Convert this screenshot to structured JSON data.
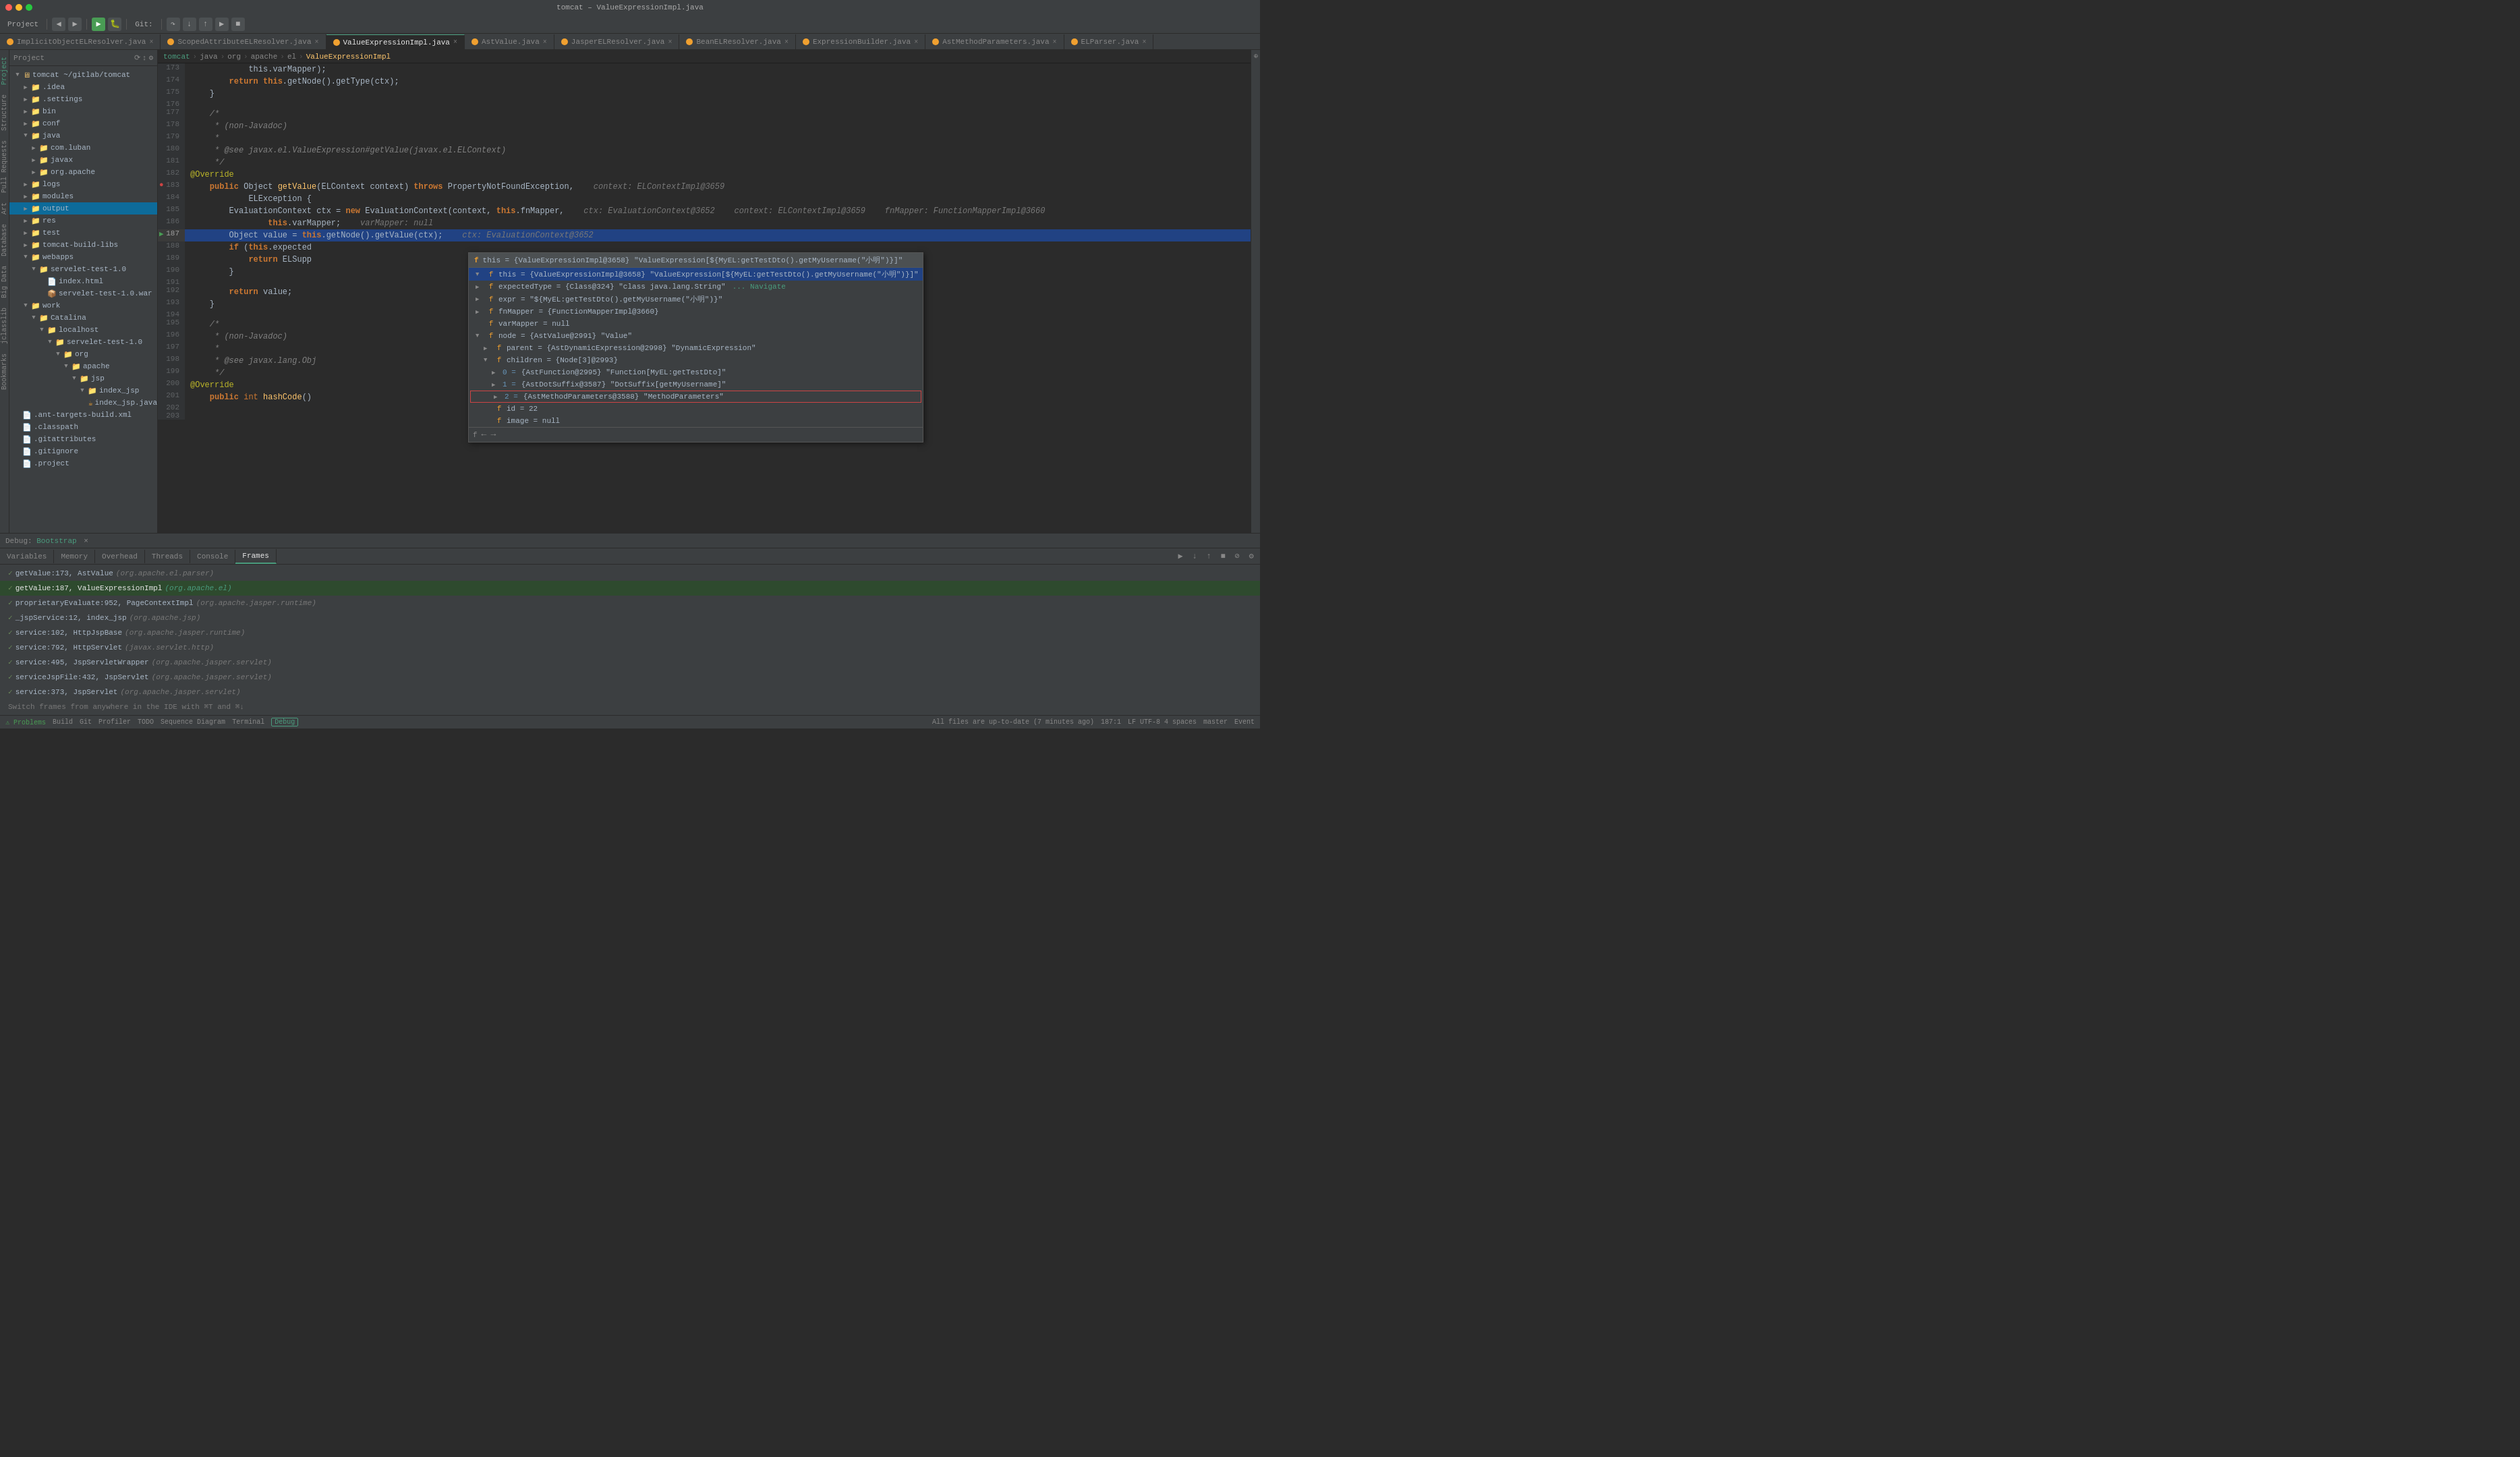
{
  "window": {
    "title": "tomcat – ValueExpressionImpl.java"
  },
  "toolbar": {
    "project_label": "Project",
    "git_label": "Git:",
    "bootstrap_label": "Bootstrap"
  },
  "tabs": [
    {
      "label": "ImplicitObjectELResolver.java",
      "active": false,
      "type": "java"
    },
    {
      "label": "ScopedAttributeELResolver.java",
      "active": false,
      "type": "java"
    },
    {
      "label": "ValueExpressionImpl.java",
      "active": true,
      "type": "java"
    },
    {
      "label": "AstValue.java",
      "active": false,
      "type": "java"
    },
    {
      "label": "JasperELResolver.java",
      "active": false,
      "type": "java"
    },
    {
      "label": "BeanELResolver.java",
      "active": false,
      "type": "java"
    },
    {
      "label": "ExpressionBuilder.java",
      "active": false,
      "type": "java"
    },
    {
      "label": "AstMethodParameters.java",
      "active": false,
      "type": "java"
    },
    {
      "label": "ELParser.java",
      "active": false,
      "type": "java"
    }
  ],
  "breadcrumb": {
    "items": [
      "tomcat",
      "java",
      "org",
      "apache",
      "el",
      "ValueExpressionImpl"
    ]
  },
  "sidebar": {
    "header": "Project",
    "items": [
      {
        "level": 0,
        "label": "tomcat ~/gitlab/tomcat",
        "expanded": true,
        "type": "root"
      },
      {
        "level": 1,
        "label": ".idea",
        "expanded": false,
        "type": "folder"
      },
      {
        "level": 1,
        "label": ".settings",
        "expanded": false,
        "type": "folder"
      },
      {
        "level": 1,
        "label": "bin",
        "expanded": false,
        "type": "folder"
      },
      {
        "level": 1,
        "label": "conf",
        "expanded": false,
        "type": "folder"
      },
      {
        "level": 1,
        "label": "java",
        "expanded": true,
        "type": "folder"
      },
      {
        "level": 2,
        "label": "com.luban",
        "expanded": false,
        "type": "folder"
      },
      {
        "level": 2,
        "label": "javax",
        "expanded": false,
        "type": "folder"
      },
      {
        "level": 2,
        "label": "org.apache",
        "expanded": false,
        "type": "folder"
      },
      {
        "level": 1,
        "label": "logs",
        "expanded": false,
        "type": "folder"
      },
      {
        "level": 1,
        "label": "modules",
        "expanded": false,
        "type": "folder"
      },
      {
        "level": 1,
        "label": "output",
        "expanded": false,
        "type": "folder",
        "selected": true
      },
      {
        "level": 1,
        "label": "res",
        "expanded": false,
        "type": "folder"
      },
      {
        "level": 1,
        "label": "test",
        "expanded": false,
        "type": "folder"
      },
      {
        "level": 1,
        "label": "tomcat-build-libs",
        "expanded": false,
        "type": "folder"
      },
      {
        "level": 1,
        "label": "webapps",
        "expanded": true,
        "type": "folder"
      },
      {
        "level": 2,
        "label": "servelet-test-1.0",
        "expanded": true,
        "type": "folder"
      },
      {
        "level": 3,
        "label": "index.html",
        "expanded": false,
        "type": "file"
      },
      {
        "level": 3,
        "label": "servelet-test-1.0.war",
        "expanded": false,
        "type": "file"
      },
      {
        "level": 1,
        "label": "work",
        "expanded": true,
        "type": "folder"
      },
      {
        "level": 2,
        "label": "Catalina",
        "expanded": true,
        "type": "folder"
      },
      {
        "level": 3,
        "label": "localhost",
        "expanded": true,
        "type": "folder"
      },
      {
        "level": 4,
        "label": "servelet-test-1.0",
        "expanded": true,
        "type": "folder"
      },
      {
        "level": 5,
        "label": "org",
        "expanded": true,
        "type": "folder"
      },
      {
        "level": 6,
        "label": "apache",
        "expanded": true,
        "type": "folder"
      },
      {
        "level": 7,
        "label": "jsp",
        "expanded": true,
        "type": "folder"
      },
      {
        "level": 8,
        "label": "index_jsp",
        "expanded": true,
        "type": "folder"
      },
      {
        "level": 9,
        "label": "index_jsp.java",
        "expanded": false,
        "type": "java"
      },
      {
        "level": 9,
        "label": "index_jsp.java",
        "expanded": false,
        "type": "java"
      },
      {
        "level": 1,
        "label": ".ant-targets-build.xml",
        "expanded": false,
        "type": "file"
      },
      {
        "level": 1,
        "label": ".classpath",
        "expanded": false,
        "type": "file"
      },
      {
        "level": 1,
        "label": ".gitattributes",
        "expanded": false,
        "type": "file"
      },
      {
        "level": 1,
        "label": ".gitignore",
        "expanded": false,
        "type": "file"
      },
      {
        "level": 1,
        "label": ".project",
        "expanded": false,
        "type": "file"
      }
    ]
  },
  "code": {
    "lines": [
      {
        "num": 173,
        "content": "            this.varMapper);"
      },
      {
        "num": 174,
        "content": "        return this.getNode().getType(ctx);"
      },
      {
        "num": 175,
        "content": "    }"
      },
      {
        "num": 176,
        "content": ""
      },
      {
        "num": 177,
        "content": "    /*"
      },
      {
        "num": 178,
        "content": "     * (non-Javadoc)"
      },
      {
        "num": 179,
        "content": "     *"
      },
      {
        "num": 180,
        "content": "     * @see javax.el.ValueExpression#getValue(javax.el.ELContext)"
      },
      {
        "num": 181,
        "content": "     */"
      },
      {
        "num": 182,
        "content": "@Override"
      },
      {
        "num": 183,
        "content": "    public Object getValue(ELContext context) throws PropertyNotFoundException,    context: ELContextImpl@3659"
      },
      {
        "num": 184,
        "content": "            ELException {"
      },
      {
        "num": 185,
        "content": "        EvaluationContext ctx = new EvaluationContext(context, this.fnMapper,    ctx: EvaluationContext@3652    context: ELContextImpl@3659    fnMapper: FunctionMapperImpl@3660"
      },
      {
        "num": 186,
        "content": "                this.varMapper;    varMapper: null"
      },
      {
        "num": 187,
        "content": "        Object value = this.getNode().getValue(ctx);    ctx: EvaluationContext@3652",
        "active": true
      },
      {
        "num": 188,
        "content": "        if (this.expected"
      },
      {
        "num": 189,
        "content": "            return ELSupp"
      },
      {
        "num": 190,
        "content": "        }"
      },
      {
        "num": 191,
        "content": ""
      },
      {
        "num": 192,
        "content": "        return value;"
      },
      {
        "num": 193,
        "content": "    }"
      },
      {
        "num": 194,
        "content": ""
      },
      {
        "num": 195,
        "content": "    /*"
      },
      {
        "num": 196,
        "content": "     * (non-Javadoc)"
      },
      {
        "num": 197,
        "content": "     *"
      },
      {
        "num": 198,
        "content": "     * @see javax.lang.Obj"
      },
      {
        "num": 199,
        "content": "     */"
      },
      {
        "num": 200,
        "content": "@Override"
      },
      {
        "num": 201,
        "content": "    public int hashCode()"
      },
      {
        "num": 202,
        "content": ""
      },
      {
        "num": 203,
        "content": ""
      }
    ]
  },
  "debug_popup": {
    "header": {
      "icon": "f",
      "text": "this = {ValueExpressionImpl@3658} \"ValueExpression[${MyEL:getTestDto().getMyUsername(\"小明\")}]\""
    },
    "items": [
      {
        "level": 1,
        "expanded": false,
        "field": "expectedType",
        "value": "{Class@324} \"class java.lang.String\"",
        "suffix": "... Navigate"
      },
      {
        "level": 1,
        "expanded": false,
        "field": "expr",
        "value": "\"${MyEL:getTestDto().getMyUsername(\\\"小明\\\")}\""
      },
      {
        "level": 1,
        "expanded": false,
        "field": "fnMapper",
        "value": "{FunctionMapperImpl@3660}"
      },
      {
        "level": 1,
        "expanded": false,
        "field": "varMapper",
        "value": "null"
      },
      {
        "level": 1,
        "expanded": true,
        "field": "node",
        "value": "{AstValue@2991} \"Value\""
      },
      {
        "level": 2,
        "expanded": false,
        "field": "parent",
        "value": "{AstDynamicExpression@2998} \"DynamicExpression\""
      },
      {
        "level": 2,
        "expanded": true,
        "field": "children",
        "value": "{Node[3]@2993}"
      },
      {
        "level": 3,
        "expanded": false,
        "field": "0",
        "value": "{AstFunction@2995} \"Function[MyEL:getTestDto]\""
      },
      {
        "level": 3,
        "expanded": false,
        "field": "1",
        "value": "{AstDotSuffix@3587} \"DotSuffix[getMyUsername]\""
      },
      {
        "level": 3,
        "expanded": false,
        "field": "2",
        "value": "{AstMethodParameters@3588} \"MethodParameters\"",
        "highlighted": true
      },
      {
        "level": 2,
        "expanded": false,
        "field": "id",
        "value": "= 22"
      },
      {
        "level": 2,
        "expanded": false,
        "field": "image",
        "value": "= null"
      }
    ]
  },
  "bottom_panel": {
    "debug_label": "Debug:",
    "bootstrap_label": "Bootstrap",
    "tabs": [
      {
        "label": "Variables",
        "active": false
      },
      {
        "label": "Memory",
        "active": false
      },
      {
        "label": "Overhead",
        "active": false
      },
      {
        "label": "Threads",
        "active": false
      },
      {
        "label": "Console",
        "active": false
      },
      {
        "label": "Frames",
        "active": true
      }
    ],
    "frames": [
      {
        "method": "getValue:173, AstValue",
        "pkg": "(org.apache.el.parser)",
        "active": false
      },
      {
        "method": "getValue:187, ValueExpressionImpl",
        "pkg": "(org.apache.el)",
        "active": true,
        "highlighted": true
      },
      {
        "method": "proprietaryEvaluate:952, PageContextImpl",
        "pkg": "(org.apache.jasper.runtime)",
        "active": false
      },
      {
        "method": "_jspService:12, index_jsp",
        "pkg": "(org.apache.jsp)",
        "active": false
      },
      {
        "method": "service:102, HttpJspBase",
        "pkg": "(org.apache.jasper.runtime)",
        "active": false
      },
      {
        "method": "service:792, HttpServlet",
        "pkg": "(javax.servlet.http)",
        "active": false
      },
      {
        "method": "service:495, JspServletWrapper",
        "pkg": "(org.apache.jasper.servlet)",
        "active": false
      },
      {
        "method": "serviceJspFile:432, JspServlet",
        "pkg": "(org.apache.jasper.servlet)",
        "active": false
      },
      {
        "method": "service:373, JspServlet",
        "pkg": "(org.apache.jasper.servlet)",
        "active": false
      },
      {
        "method": "...",
        "pkg": ""
      }
    ]
  },
  "status_bar": {
    "problems": "Problems",
    "build": "Build",
    "git": "Git",
    "profiler": "Profiler",
    "todo": "TODO",
    "sequence_diagram": "Sequence Diagram",
    "terminal": "Terminal",
    "debug": "Debug",
    "all_files_saved": "All files are up-to-date (7 minutes ago)",
    "position": "187:1",
    "encoding": "LF  UTF-8  4 spaces",
    "git_branch": "master",
    "event": "Event"
  }
}
